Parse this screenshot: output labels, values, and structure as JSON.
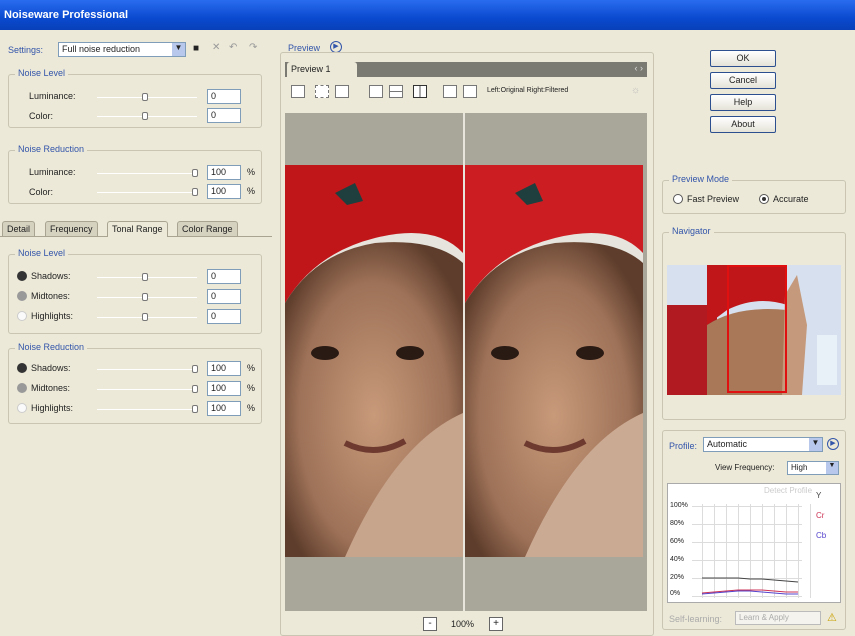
{
  "window": {
    "title": "Noiseware Professional"
  },
  "settings": {
    "label": "Settings:",
    "value": "Full noise reduction"
  },
  "noise_level": {
    "title": "Noise Level",
    "luminance_label": "Luminance:",
    "luminance_value": "0",
    "color_label": "Color:",
    "color_value": "0"
  },
  "noise_reduction": {
    "title": "Noise Reduction",
    "luminance_label": "Luminance:",
    "luminance_value": "100",
    "color_label": "Color:",
    "color_value": "100",
    "unit": "%"
  },
  "tabs": [
    {
      "label": "Detail"
    },
    {
      "label": "Frequency"
    },
    {
      "label": "Tonal Range"
    },
    {
      "label": "Color Range"
    }
  ],
  "tonal": {
    "level_title": "Noise Level",
    "reduction_title": "Noise Reduction",
    "shadows_label": "Shadows:",
    "midtones_label": "Midtones:",
    "highlights_label": "Highlights:",
    "level_shadows": "0",
    "level_midtones": "0",
    "level_highlights": "0",
    "red_shadows": "100",
    "red_midtones": "100",
    "red_highlights": "100",
    "unit": "%"
  },
  "preview": {
    "title": "Preview",
    "tab": "Preview 1",
    "split_label": "Left:Original Right:Filtered",
    "zoom": "100%",
    "zoom_minus": "-",
    "zoom_plus": "+"
  },
  "buttons": {
    "ok": "OK",
    "cancel": "Cancel",
    "help": "Help",
    "about": "About"
  },
  "preview_mode": {
    "title": "Preview Mode",
    "fast": "Fast Preview",
    "accurate": "Accurate",
    "selected": "accurate"
  },
  "navigator": {
    "title": "Navigator"
  },
  "profile": {
    "label": "Profile:",
    "value": "Automatic",
    "view_freq_label": "View Frequency:",
    "view_freq_value": "High",
    "chart_title": "Detect Profile",
    "y_ticks": [
      "100%",
      "80%",
      "60%",
      "40%",
      "20%",
      "0%"
    ],
    "legend": [
      "Y",
      "Cr",
      "Cb"
    ],
    "self_learning_label": "Self-learning:",
    "self_learning_value": "Learn & Apply"
  },
  "colors": {
    "accent": "#3355aa",
    "title_blue": "#0a4ad0",
    "nav_rect": "#e01010",
    "series_y": "#444444",
    "series_cr": "#cc3355",
    "series_cb": "#5544cc"
  }
}
